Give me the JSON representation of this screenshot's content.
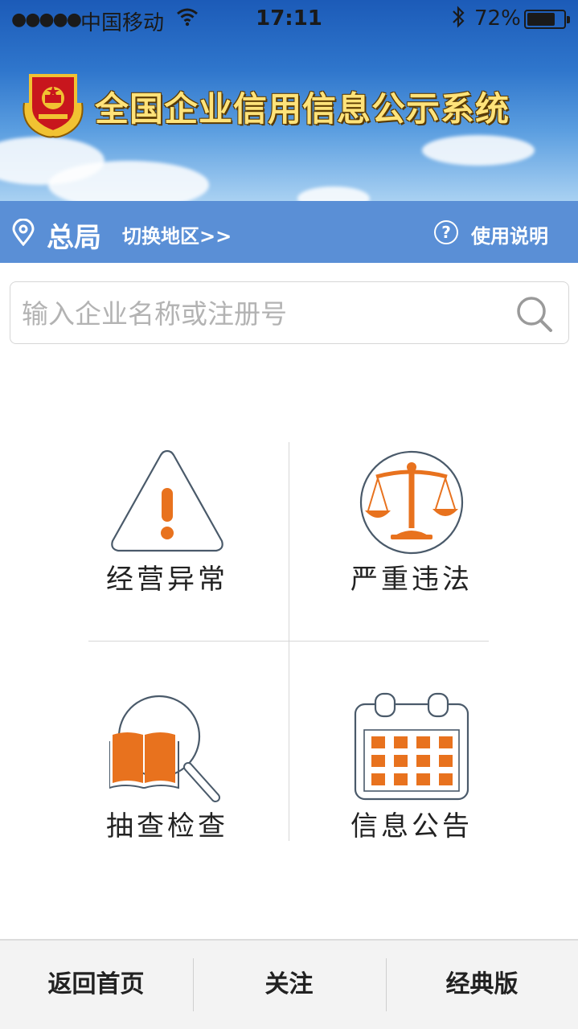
{
  "status_bar": {
    "signal": "●●●●●",
    "carrier": "中国移动",
    "time": "17:11",
    "battery_percent": "72%"
  },
  "header": {
    "title": "全国企业信用信息公示系统"
  },
  "location_bar": {
    "region": "总局",
    "switch_label": "切换地区>>",
    "help_label": "使用说明"
  },
  "search": {
    "placeholder": "输入企业名称或注册号",
    "value": ""
  },
  "menu": [
    {
      "label": "经营异常",
      "icon": "warning-triangle-icon"
    },
    {
      "label": "严重违法",
      "icon": "scales-icon"
    },
    {
      "label": "抽查检查",
      "icon": "book-magnifier-icon"
    },
    {
      "label": "信息公告",
      "icon": "calendar-icon"
    }
  ],
  "bottom_nav": [
    {
      "label": "返回首页"
    },
    {
      "label": "关注"
    },
    {
      "label": "经典版"
    }
  ],
  "colors": {
    "accent_orange": "#e8721e",
    "location_bar": "#5a8fd6",
    "title_gold": "#ffe37a"
  }
}
